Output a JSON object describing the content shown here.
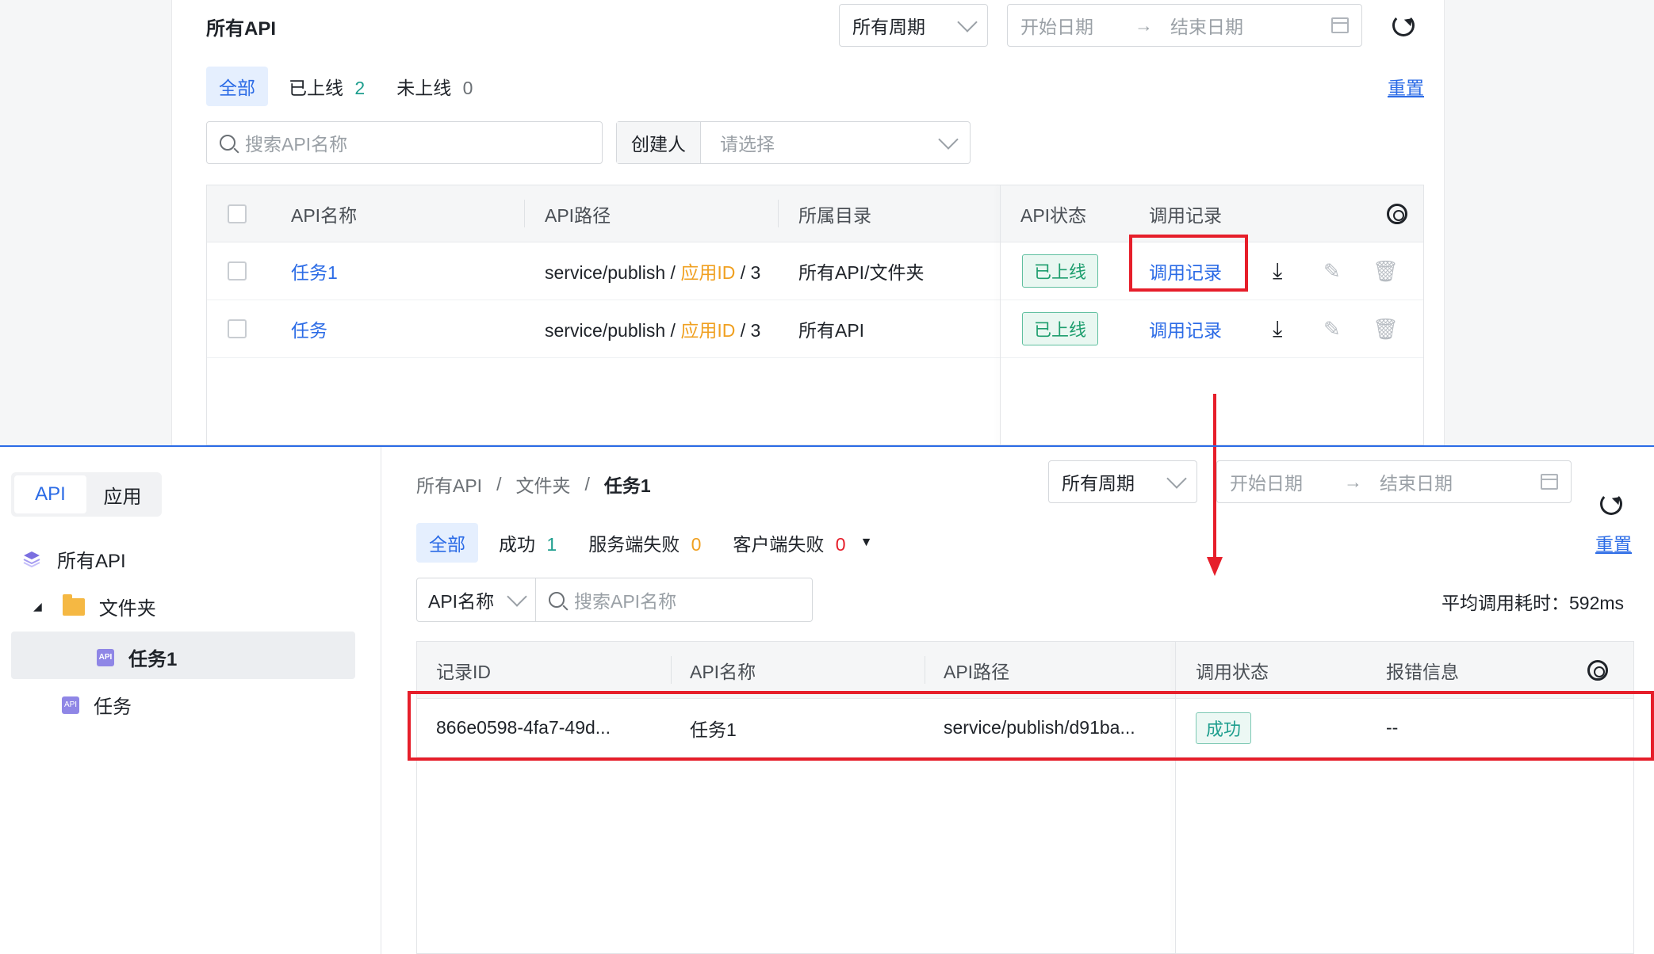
{
  "top": {
    "title": "所有API",
    "period": "所有周期",
    "start_date": "开始日期",
    "end_date": "结束日期",
    "arrow": "→",
    "tabs": [
      {
        "label": "全部"
      },
      {
        "label": "已上线",
        "count": "2"
      },
      {
        "label": "未上线",
        "count": "0"
      }
    ],
    "reset": "重置",
    "search_placeholder": "搜索API名称",
    "creator_label": "创建人",
    "creator_placeholder": "请选择",
    "columns": [
      "API名称",
      "API路径",
      "所属目录",
      "API状态",
      "调用记录"
    ],
    "rows": [
      {
        "name": "任务1",
        "path_prefix": "service/publish /",
        "path_app": "应用ID",
        "path_suffix": "/ 3",
        "dir": "所有API/文件夹",
        "status": "已上线",
        "record": "调用记录"
      },
      {
        "name": "任务",
        "path_prefix": "service/publish /",
        "path_app": "应用ID",
        "path_suffix": "/ 3",
        "dir": "所有API",
        "status": "已上线",
        "record": "调用记录"
      }
    ]
  },
  "sidebar": {
    "seg": [
      "API",
      "应用"
    ],
    "tree": [
      "所有API",
      "文件夹",
      "任务1",
      "任务"
    ]
  },
  "bottom": {
    "breadcrumb": [
      "所有API",
      "文件夹",
      "任务1"
    ],
    "sep": "/",
    "period": "所有周期",
    "start_date": "开始日期",
    "end_date": "结束日期",
    "arrow": "→",
    "tabs": [
      {
        "label": "全部"
      },
      {
        "label": "成功",
        "count": "1"
      },
      {
        "label": "服务端失败",
        "count": "0"
      },
      {
        "label": "客户端失败",
        "count": "0"
      }
    ],
    "reset": "重置",
    "search_field": "API名称",
    "search_placeholder": "搜索API名称",
    "avg_time": "平均调用耗时：592ms",
    "columns": [
      "记录ID",
      "API名称",
      "API路径",
      "调用状态",
      "报错信息"
    ],
    "rows": [
      {
        "id": "866e0598-4fa7-49d...",
        "name": "任务1",
        "path": "service/publish/d91ba...",
        "status": "成功",
        "error": "--"
      }
    ]
  },
  "colors": {
    "accent": "#2b6be6",
    "highlight": "#e61e2a",
    "success": "#1e9e8e",
    "warning": "#f0a020"
  }
}
